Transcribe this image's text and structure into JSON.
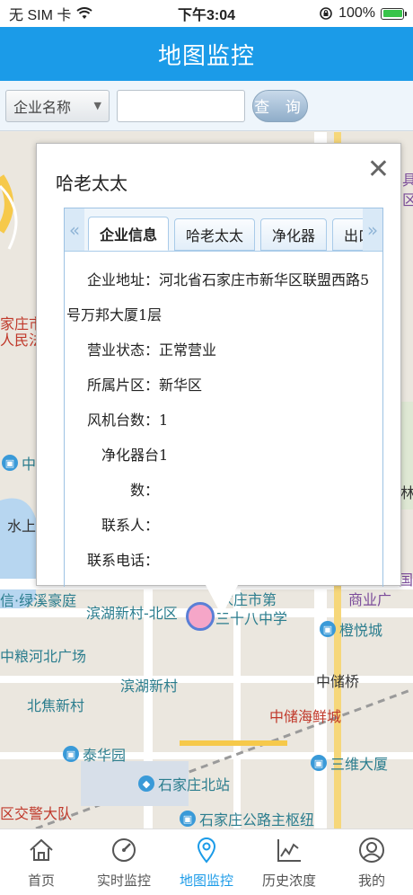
{
  "status_bar": {
    "carrier": "无 SIM 卡",
    "time": "下午3:04",
    "battery": "100%",
    "battery_level": 1.0
  },
  "nav": {
    "title": "地图监控"
  },
  "search": {
    "select_value": "企业名称",
    "input_value": "",
    "button_label": "查 询"
  },
  "map_labels": [
    "家庄市中",
    "人民法院",
    "中化",
    "水上",
    "信·绿溪豪庭",
    "滨湖新村-北区",
    "家庄市第",
    "三十八中学",
    "橙悦城",
    "商业广",
    "中粮河北广场",
    "滨湖新村",
    "北焦新村",
    "中储桥",
    "中储海鲜城",
    "泰华园",
    "三维大厦",
    "石家庄北站",
    "区交警大队",
    "石家庄公路主枢纽",
    "东具",
    "团区",
    "林",
    "国际"
  ],
  "popup": {
    "title": "哈老太太",
    "close_label": "✕",
    "tabs": [
      "企业信息",
      "哈老太太",
      "净化器",
      "出口"
    ],
    "active_tab": 0,
    "fields": {
      "address_label": "企业地址",
      "address_value": "河北省石家庄市新华区联盟西路5",
      "address_value_cont": "号万邦大厦1层",
      "status_label": "营业状态",
      "status_value": "正常营业",
      "district_label": "所属片区",
      "district_value": "新华区",
      "fans_label": "风机台数",
      "fans_value": "1",
      "purifier_label": "净化器台数",
      "purifier_value": "1",
      "contact_label": "联系人",
      "contact_value": "",
      "phone_label": "联系电话",
      "phone_value": ""
    }
  },
  "tabbar": {
    "items": [
      {
        "label": "首页",
        "icon": "home-icon"
      },
      {
        "label": "实时监控",
        "icon": "gauge-icon"
      },
      {
        "label": "地图监控",
        "icon": "location-pin-icon"
      },
      {
        "label": "历史浓度",
        "icon": "line-chart-icon"
      },
      {
        "label": "我的",
        "icon": "user-icon"
      }
    ],
    "active": 2,
    "active_color": "#1b9be8",
    "inactive_color": "#555555"
  },
  "colors": {
    "brand": "#1b9be8"
  }
}
